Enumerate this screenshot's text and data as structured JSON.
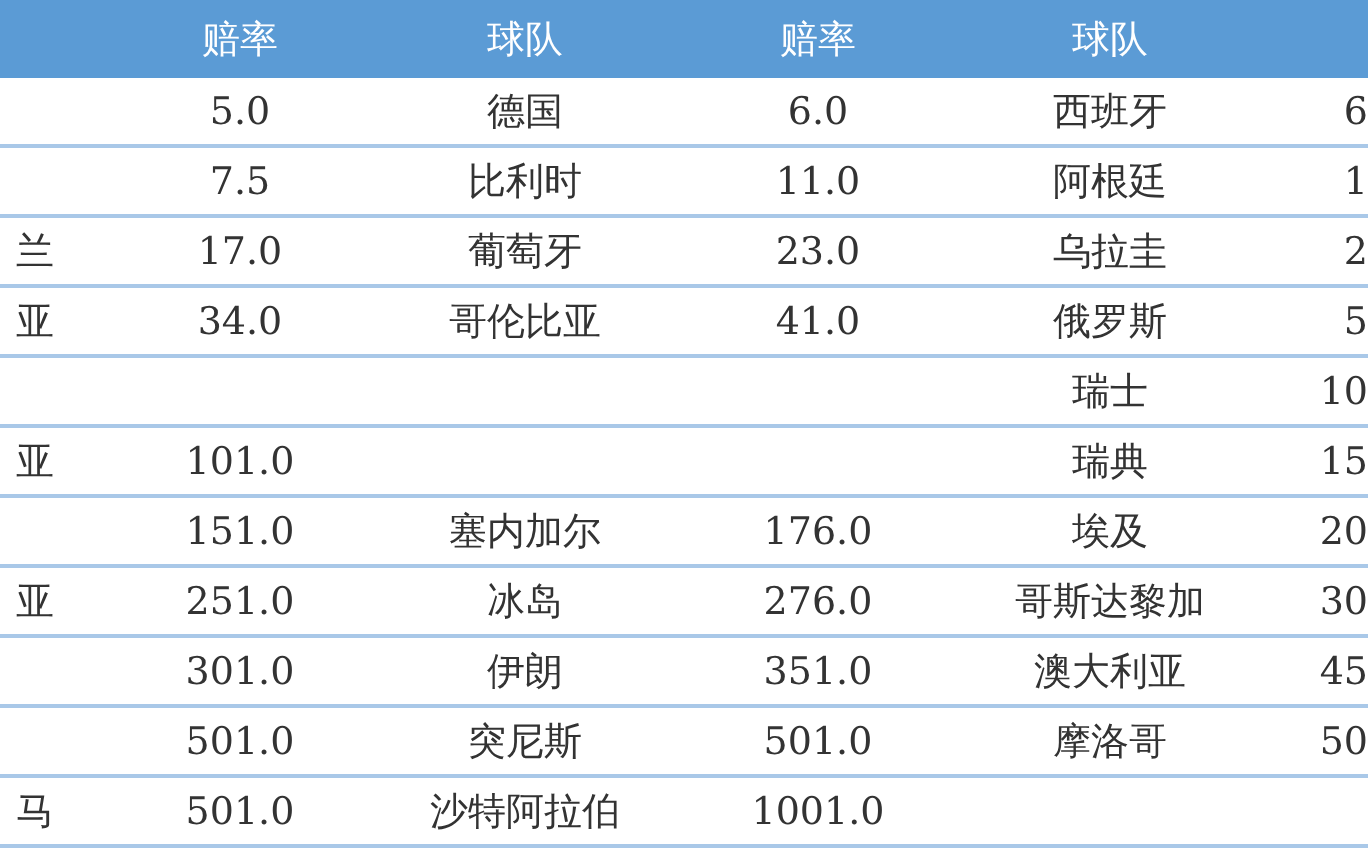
{
  "table": {
    "columns": [
      null,
      "赔率",
      "球队",
      "赔率",
      "球队",
      null
    ],
    "rows": [
      {
        "cells": [
          null,
          "5.0",
          "德国",
          "6.0",
          "西班牙",
          "6"
        ]
      },
      {
        "cells": [
          null,
          "7.5",
          "比利时",
          "11.0",
          "阿根廷",
          "1"
        ]
      },
      {
        "cells": [
          "兰",
          "17.0",
          "葡萄牙",
          "23.0",
          "乌拉圭",
          "2"
        ]
      },
      {
        "cells": [
          "亚",
          "34.0",
          "哥伦比亚",
          "41.0",
          "俄罗斯",
          "5"
        ]
      },
      {
        "cells": [
          null,
          null,
          null,
          null,
          "瑞士",
          "10"
        ]
      },
      {
        "cells": [
          "亚",
          "101.0",
          null,
          null,
          "瑞典",
          "15"
        ]
      },
      {
        "cells": [
          null,
          "151.0",
          "塞内加尔",
          "176.0",
          "埃及",
          "20"
        ]
      },
      {
        "cells": [
          "亚",
          "251.0",
          "冰岛",
          "276.0",
          "哥斯达黎加",
          "30"
        ]
      },
      {
        "cells": [
          null,
          "301.0",
          "伊朗",
          "351.0",
          "澳大利亚",
          "45"
        ]
      },
      {
        "cells": [
          null,
          "501.0",
          "突尼斯",
          "501.0",
          "摩洛哥",
          "50"
        ]
      },
      {
        "cells": [
          "马",
          "501.0",
          "沙特阿拉伯",
          "1001.0",
          null,
          null
        ]
      }
    ]
  }
}
